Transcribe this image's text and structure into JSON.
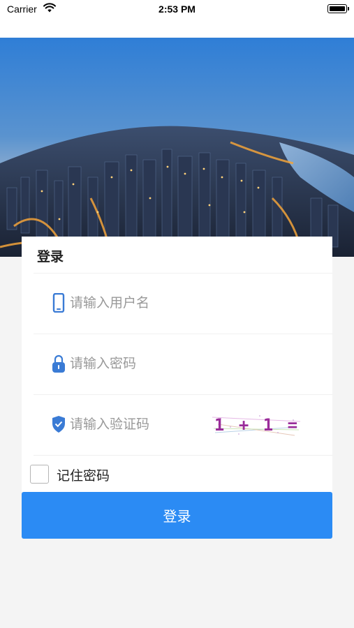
{
  "status_bar": {
    "carrier": "Carrier",
    "time": "2:53 PM",
    "wifi_icon": "wifi-icon",
    "battery_icon": "battery-icon"
  },
  "hero": {
    "description": "city-skyline-photo"
  },
  "login_card": {
    "title": "登录",
    "username": {
      "placeholder": "请输入用户名",
      "value": "",
      "icon": "phone-icon"
    },
    "password": {
      "placeholder": "请输入密码",
      "value": "",
      "icon": "lock-icon"
    },
    "captcha": {
      "placeholder": "请输入验证码",
      "value": "",
      "icon": "shield-check-icon",
      "image_text": "1 + 1 ="
    },
    "remember": {
      "label": "记住密码",
      "checked": false
    }
  },
  "login_button": {
    "label": "登录"
  },
  "colors": {
    "primary": "#2b8bf4",
    "icon_blue": "#3a7bd5",
    "background": "#f4f4f4"
  }
}
